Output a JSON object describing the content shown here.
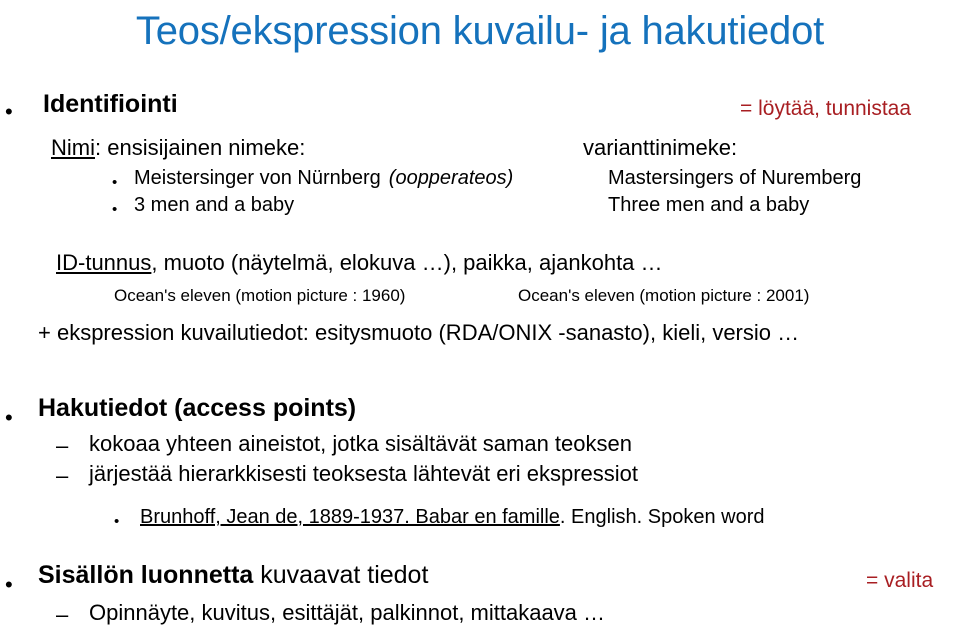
{
  "slide": {
    "title": "Teos/ekspression kuvailu- ja hakutiedot",
    "title_color": "#1572BC",
    "note_color": "#A81E22",
    "background": "#ffffff"
  },
  "sections": {
    "identifiointi": {
      "heading": "Identifiointi",
      "note": "= löytää, tunnistaa",
      "nimi_label": "Nimi",
      "nimi_rest": ": ensisijainen nimeke:",
      "varianttinimeke": "varianttinimeke:",
      "examples": [
        {
          "left": "Meistersinger von Nürnberg",
          "left_italic": "(oopperateos)",
          "right": "Mastersingers of Nuremberg"
        },
        {
          "left": "3 men and a baby",
          "left_italic": "",
          "right": "Three men and a baby"
        }
      ],
      "idtunnus_label": "ID-tunnus",
      "idtunnus_rest": ", muoto (näytelmä, elokuva …), paikka, ajankohta …",
      "ocean_left": "Ocean's eleven (motion picture : 1960)",
      "ocean_right": "Ocean's eleven (motion picture : 2001)",
      "ekspressio_line": "+ ekspression kuvailutiedot: esitysmuoto (RDA/ONIX -sanasto), kieli, versio …"
    },
    "hakutiedot": {
      "heading": "Hakutiedot (access points)",
      "points": [
        "kokoaa yhteen aineistot, jotka sisältävät saman teoksen",
        "järjestää hierarkkisesti teoksesta lähtevät eri ekspressiot"
      ],
      "example_underlined": "Brunhoff, Jean de, 1889-1937. Babar en famille",
      "example_plain": ". English. Spoken word"
    },
    "sisallon": {
      "heading_bold": "Sisällön luonnetta",
      "heading_rest": " kuvaavat tiedot",
      "note": "= valita",
      "points": [
        "Opinnäyte, kuvitus, esittäjät, palkinnot, mittakaava …"
      ]
    }
  },
  "glyphs": {
    "bullet": "•",
    "dash": "–",
    "small_bullet": "•"
  }
}
